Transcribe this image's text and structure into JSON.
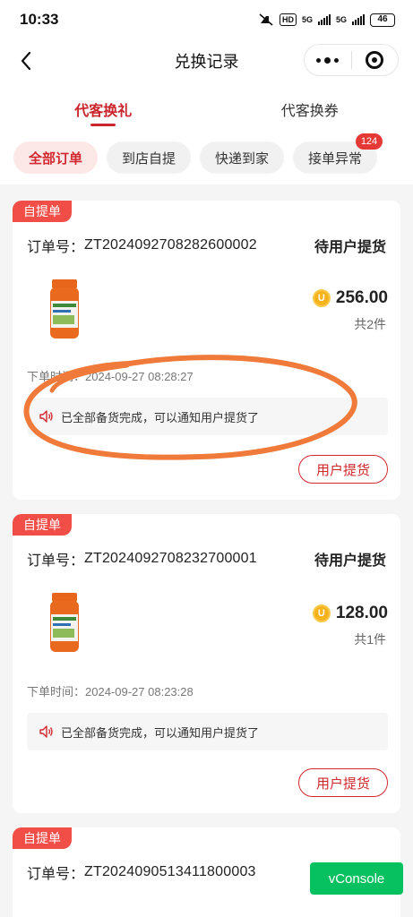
{
  "status_bar": {
    "time": "10:33",
    "hd": "HD",
    "net1": "5G",
    "net2": "5G",
    "battery": "46"
  },
  "nav": {
    "title": "兑换记录"
  },
  "main_tabs": [
    {
      "label": "代客换礼",
      "active": true
    },
    {
      "label": "代客换券",
      "active": false
    }
  ],
  "filters": [
    {
      "label": "全部订单",
      "active": true
    },
    {
      "label": "到店自提",
      "active": false
    },
    {
      "label": "快递到家",
      "active": false
    },
    {
      "label": "接单异常",
      "active": false,
      "badge": "124"
    }
  ],
  "orders": [
    {
      "tag": "自提单",
      "order_no_label": "订单号：",
      "order_no": "ZT2024092708282600002",
      "status": "待用户提货",
      "price": "256.00",
      "quantity": "共2件",
      "time_label": "下单时间：",
      "time": "2024-09-27 08:28:27",
      "notice": "已全部备货完成，可以通知用户提货了",
      "button": "用户提货"
    },
    {
      "tag": "自提单",
      "order_no_label": "订单号：",
      "order_no": "ZT2024092708232700001",
      "status": "待用户提货",
      "price": "128.00",
      "quantity": "共1件",
      "time_label": "下单时间：",
      "time": "2024-09-27 08:23:28",
      "notice": "已全部备货完成，可以通知用户提货了",
      "button": "用户提货"
    },
    {
      "tag": "自提单",
      "order_no_label": "订单号：",
      "order_no": "ZT2024090513411800003"
    }
  ],
  "vconsole": {
    "label": "vConsole"
  },
  "colors": {
    "brand_red": "#c9252b",
    "tag_red": "#f24e48",
    "annotation_orange": "#f07a3a",
    "vconsole_green": "#07c160"
  }
}
